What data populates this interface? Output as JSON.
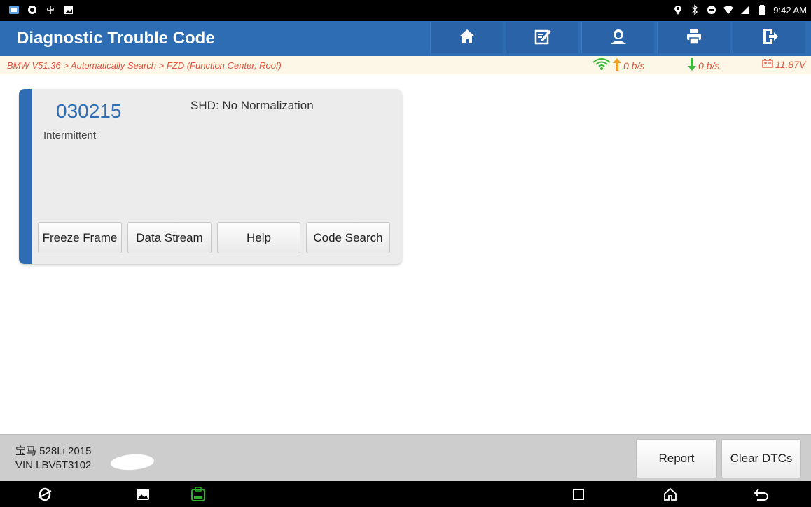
{
  "status_bar": {
    "time": "9:42 AM",
    "left_icons": [
      "app-icon",
      "browser-icon",
      "usb-icon",
      "image-icon"
    ],
    "right_icons": [
      "location-icon",
      "bluetooth-icon",
      "do-not-disturb-icon",
      "wifi-icon",
      "signal-icon",
      "battery-icon"
    ]
  },
  "header": {
    "title": "Diagnostic Trouble Code",
    "toolbar": [
      "home-icon",
      "edit-icon",
      "support-icon",
      "print-icon",
      "exit-icon"
    ]
  },
  "breadcrumb": {
    "path": "BMW V51.36 > Automatically Search > FZD (Function Center, Roof)",
    "upload_rate": "0 b/s",
    "download_rate": "0 b/s",
    "voltage": "11.87V"
  },
  "dtc": {
    "code": "030215",
    "status": "Intermittent",
    "description": "SHD: No Normalization",
    "buttons": {
      "freeze_frame": "Freeze Frame",
      "data_stream": "Data Stream",
      "help": "Help",
      "code_search": "Code Search"
    }
  },
  "footer": {
    "vehicle": "宝马 528Li 2015",
    "vin": "VIN LBV5T3102",
    "report": "Report",
    "clear_dtcs": "Clear DTCs"
  },
  "nav_bar": [
    "browser-icon",
    "gallery-icon",
    "vci-icon",
    "recent-apps-icon",
    "home-icon",
    "back-icon"
  ],
  "colors": {
    "header_blue": "#2e6cb3",
    "breadcrumb_text": "#e0553f",
    "breadcrumb_bg": "#fcf7e6",
    "wifi_green": "#3db83a",
    "upload_orange": "#f0a020",
    "download_green": "#3db83a",
    "vci_green": "#2fb12f"
  }
}
